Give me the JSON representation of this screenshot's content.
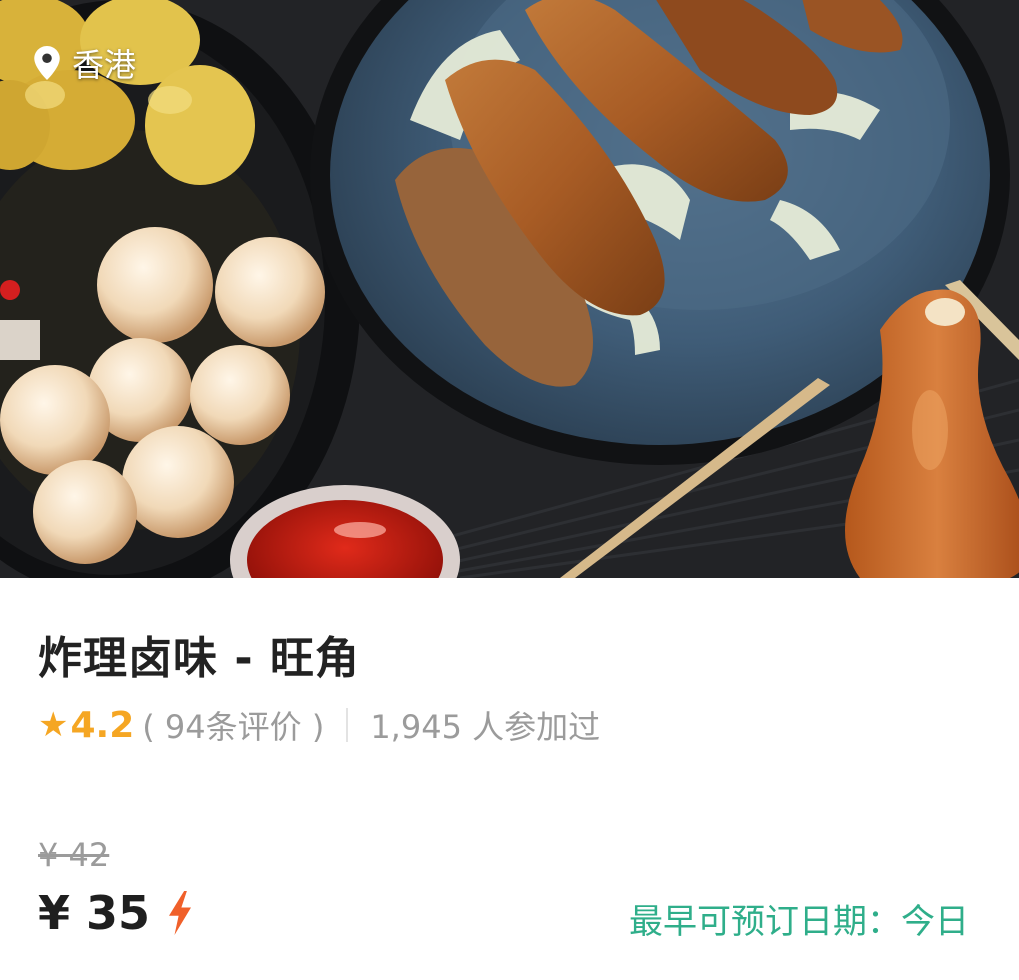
{
  "hero": {
    "location": "香港",
    "location_icon": "map-pin-icon"
  },
  "product": {
    "title": "炸理卤味 - 旺角",
    "rating": {
      "star_icon": "star-icon",
      "star_glyph": "★",
      "score": "4.2",
      "reviews": "( 94条评价 )"
    },
    "participants": "1,945 人参加过",
    "original_price": "¥ 42",
    "price": "¥ 35",
    "instant_icon": "lightning-bolt-icon",
    "booking_label": "最早可预订日期：今日"
  },
  "colors": {
    "rating": "#f5a623",
    "booking": "#2fae8a",
    "instant": "#f0602a",
    "muted_text": "#9b9b9b"
  }
}
